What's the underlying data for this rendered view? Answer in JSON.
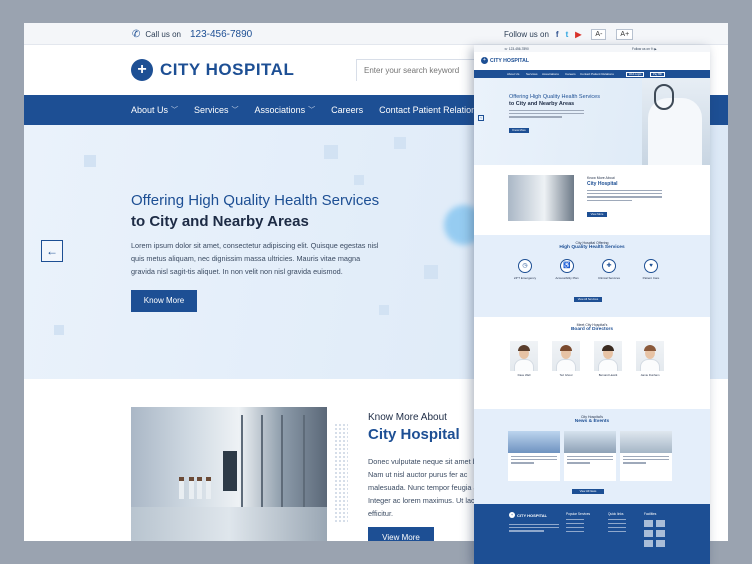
{
  "topbar": {
    "call_label": "Call us on",
    "phone": "123-456-7890",
    "follow_label": "Follow us on",
    "social": [
      "f",
      "t",
      "▶"
    ],
    "font_smaller": "A-",
    "font_larger": "A+"
  },
  "header": {
    "logo_text": "CITY HOSPITAL",
    "search_placeholder": "Enter your search keyword"
  },
  "nav": {
    "items": [
      "About Us",
      "Services",
      "Associations",
      "Careers",
      "Contact Patient Relations"
    ]
  },
  "hero": {
    "title_line1": "Offering High Quality Health Services",
    "title_line2": "to City and Nearby Areas",
    "body": "Lorem ipsum dolor sit amet, consectetur adipiscing elit. Quisque egestas nisl quis metus aliquam, nec dignissim massa ultricies. Mauris vitae magna gravida nisl sagit-tis aliquet. In non velit non nisl gravida euismod.",
    "button": "Know More",
    "prev_arrow": "←"
  },
  "about": {
    "kicker": "Know More About",
    "title": "City Hospital",
    "body": "Donec vulputate neque sit amet bus. Nam ut nisl auctor purus fer ac malesuada. Nunc tempor feugia ac. Integer ac lorem maximus. Ut lacus efficitur.",
    "button": "View More"
  },
  "overlay": {
    "logo_text": "CITY HOSPITAL",
    "hero_title_line1": "Offering High Quality Health Services",
    "hero_title_line2": "to City and Nearby Areas",
    "about_kicker": "Know More About",
    "about_title": "City Hospital",
    "services_kicker": "City Hospital Offering",
    "services_title": "High Quality Health Services",
    "services": [
      "24*7 Emergency",
      "Accessibility Plan",
      "Clinical Services",
      "Patient Care"
    ],
    "board_kicker": "Meet City Hospital's",
    "board_title": "Board of Directors",
    "directors": [
      "Dave Wall",
      "Teri Ghoul",
      "Bernard Hewitt",
      "Jamie Dunham"
    ],
    "news_kicker": "City Hospital's",
    "news_title": "News & Events",
    "footer_logo": "CITY HOSPITAL",
    "footer_cols": [
      "Popular Services",
      "Quick links",
      "Facilities"
    ]
  }
}
